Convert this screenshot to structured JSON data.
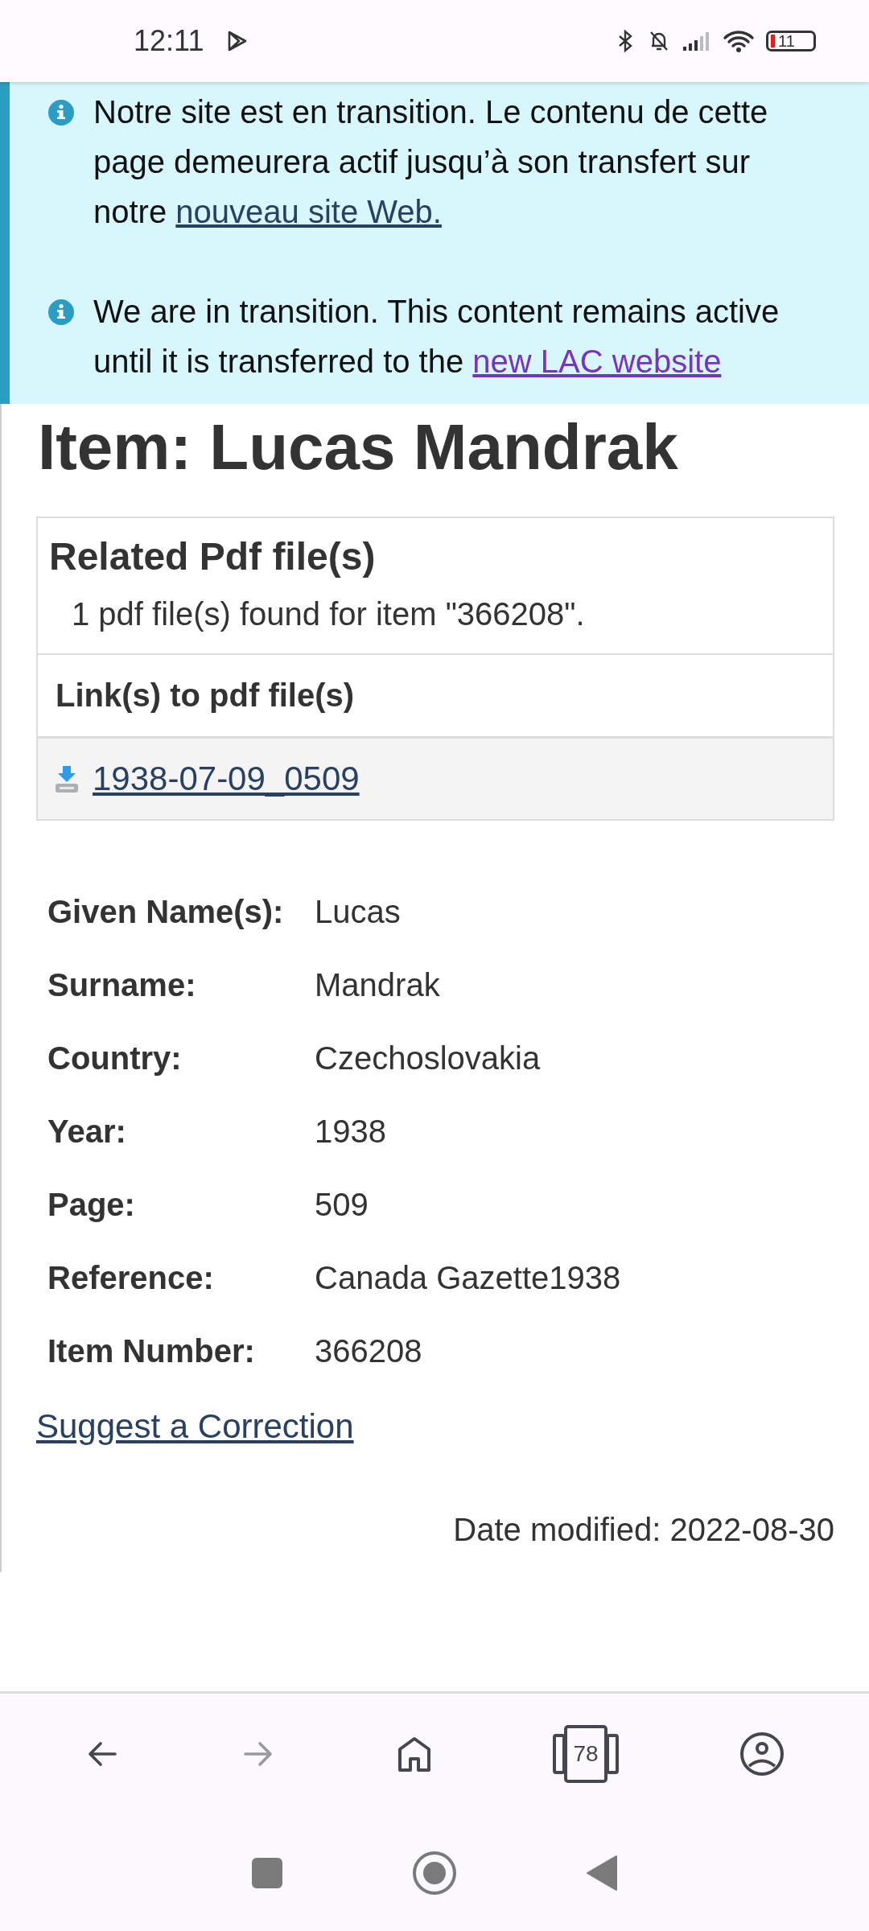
{
  "status_bar": {
    "time": "12:11",
    "battery": "11"
  },
  "banner": {
    "messages": [
      {
        "text": "Notre site est en transition. Le contenu de cette page demeurera actif jusqu’à son transfert sur notre ",
        "link": "nouveau site Web.",
        "visited": false
      },
      {
        "text": "We are in transition. This content remains active until it is transferred to the ",
        "link": "new LAC website",
        "visited": true
      }
    ]
  },
  "title": "Item: Lucas Mandrak",
  "pdf_panel": {
    "heading": "Related Pdf file(s)",
    "summary": "1 pdf file(s) found for item \"366208\".",
    "links_heading": "Link(s) to pdf file(s)",
    "files": [
      {
        "label": "1938-07-09_0509"
      }
    ]
  },
  "details": [
    {
      "label": "Given Name(s):",
      "value": "Lucas"
    },
    {
      "label": "Surname:",
      "value": "Mandrak"
    },
    {
      "label": "Country:",
      "value": "Czechoslovakia"
    },
    {
      "label": "Year:",
      "value": "1938"
    },
    {
      "label": "Page:",
      "value": "509"
    },
    {
      "label": "Reference:",
      "value": "Canada Gazette1938"
    },
    {
      "label": "Item Number:",
      "value": "366208"
    }
  ],
  "correction_link": "Suggest a Correction",
  "date_modified": "Date modified: 2022-08-30",
  "browser_toolbar": {
    "back": {
      "disabled": false
    },
    "forward": {
      "disabled": true
    },
    "tab_count": "78"
  }
}
